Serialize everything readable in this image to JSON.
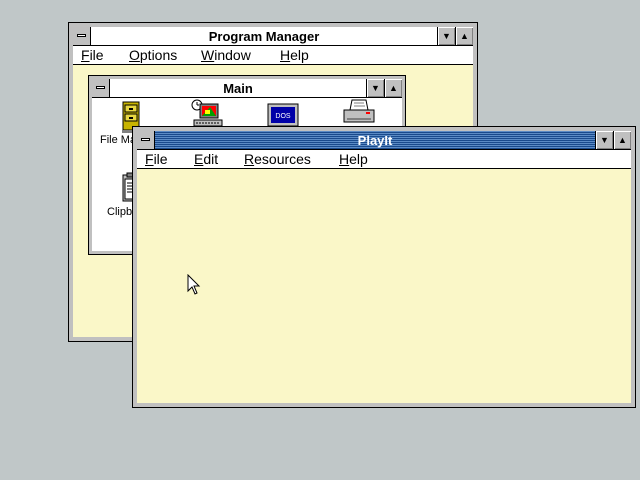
{
  "program_manager": {
    "title": "Program Manager",
    "menu": [
      {
        "label": "File",
        "accel": "F",
        "rest": "ile"
      },
      {
        "label": "Options",
        "accel": "O",
        "rest": "ptions"
      },
      {
        "label": "Window",
        "accel": "W",
        "rest": "indow"
      },
      {
        "label": "Help",
        "accel": "H",
        "rest": "elp"
      }
    ],
    "main_group": {
      "title": "Main",
      "icons": [
        {
          "name": "file-manager-icon",
          "label": "File Ma"
        },
        {
          "name": "control-panel-icon",
          "label": ""
        },
        {
          "name": "ms-dos-prompt-icon",
          "label": "DOS"
        },
        {
          "name": "print-manager-icon",
          "label": ""
        },
        {
          "name": "clipboard-viewer-icon",
          "label": "Clipb"
        }
      ]
    }
  },
  "playit": {
    "title": "PlayIt",
    "menu": [
      {
        "label": "File",
        "accel": "F",
        "rest": "ile"
      },
      {
        "label": "Edit",
        "accel": "E",
        "rest": "dit"
      },
      {
        "label": "Resources",
        "accel": "R",
        "rest": "esources"
      },
      {
        "label": "Help",
        "accel": "H",
        "rest": "elp"
      }
    ]
  },
  "colors": {
    "desktop": "#c0c7c8",
    "active_title": "#1a4a8c",
    "client_bg": "#fffdd0"
  }
}
